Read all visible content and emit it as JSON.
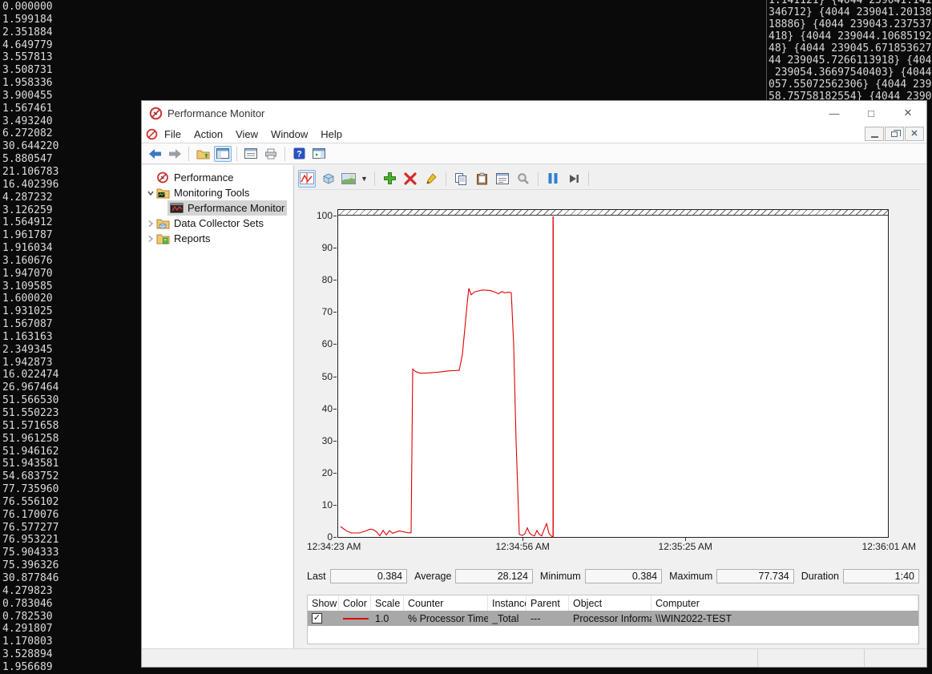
{
  "background_console": {
    "left_values": [
      "0.000000",
      "1.599184",
      "2.351884",
      "4.649779",
      "3.557813",
      "3.508731",
      "1.958336",
      "3.900455",
      "1.567461",
      "3.493240",
      "6.272082",
      "30.644220",
      "5.880547",
      "21.106783",
      "16.402396",
      "4.287232",
      "3.126259",
      "1.564912",
      "1.961787",
      "1.916034",
      "3.160676",
      "1.947070",
      "3.109585",
      "1.600020",
      "1.931025",
      "1.567087",
      "1.163163",
      "2.349345",
      "1.942873",
      "16.022474",
      "26.967464",
      "51.566530",
      "51.550223",
      "51.571658",
      "51.961258",
      "51.946162",
      "51.943581",
      "54.683752",
      "77.735960",
      "76.556102",
      "76.170076",
      "76.577277",
      "76.953221",
      "75.904333",
      "75.396326",
      "30.877846",
      "4.279823",
      "0.783046",
      "0.782530",
      "4.291807",
      "1.170803",
      "3.528894",
      "1.956689"
    ],
    "top_right_lines": [
      "1.141121} {4044 239041.141",
      "346712} {4044 239041.20138",
      "18886} {4044 239043.237537",
      "418} {4044 239044.10685192",
      "48} {4044 239045.671853627",
      "44 239045.7266113918} {404",
      " 239054.36697540403} {4044",
      "057.55072562306} {4044 239",
      "58.75758182554} {4044 2390"
    ]
  },
  "window": {
    "title": "Performance Monitor",
    "controls": {
      "minimize": "—",
      "maximize": "□",
      "close": "✕"
    }
  },
  "menu": {
    "items": [
      "File",
      "Action",
      "View",
      "Window",
      "Help"
    ]
  },
  "tree": {
    "root": "Performance",
    "items": [
      {
        "label": "Monitoring Tools",
        "expanded": true
      },
      {
        "label": "Performance Monitor",
        "selected": true
      },
      {
        "label": "Data Collector Sets",
        "expanded": false
      },
      {
        "label": "Reports",
        "expanded": false
      }
    ]
  },
  "chart_data": {
    "type": "line",
    "title": "",
    "xlabel": "",
    "ylabel": "",
    "ylim": [
      0,
      100
    ],
    "grid": false,
    "y_ticks": [
      100,
      90,
      80,
      70,
      60,
      50,
      40,
      30,
      20,
      10,
      0
    ],
    "x_tick_labels": [
      "12:34:23 AM",
      "12:34:56 AM",
      "12:35:25 AM",
      "12:36:01 AM"
    ],
    "x_tick_percents": [
      0,
      33.7,
      63.3,
      100
    ],
    "time_marker_percent": 39.1,
    "plot_width_units": 686,
    "series": [
      {
        "name": "% Processor Time",
        "color": "#e00000",
        "points": [
          [
            3,
            3.5
          ],
          [
            10,
            2.2
          ],
          [
            16,
            1.5
          ],
          [
            26,
            1.5
          ],
          [
            33,
            2.0
          ],
          [
            40,
            2.7
          ],
          [
            44,
            2.5
          ],
          [
            48,
            1.8
          ],
          [
            52,
            0.6
          ],
          [
            56,
            2.3
          ],
          [
            60,
            0.9
          ],
          [
            64,
            2.2
          ],
          [
            68,
            1.4
          ],
          [
            76,
            2.1
          ],
          [
            81,
            1.9
          ],
          [
            88,
            1.5
          ],
          [
            91,
            1.6
          ],
          [
            93,
            52.5
          ],
          [
            96,
            51.8
          ],
          [
            101,
            51.3
          ],
          [
            106,
            51.2
          ],
          [
            113,
            51.3
          ],
          [
            123,
            51.5
          ],
          [
            131,
            51.7
          ],
          [
            136,
            51.9
          ],
          [
            143,
            52.0
          ],
          [
            151,
            52.1
          ],
          [
            155,
            57.0
          ],
          [
            158,
            65.0
          ],
          [
            161,
            73.0
          ],
          [
            163,
            77.6
          ],
          [
            166,
            75.6
          ],
          [
            170,
            76.5
          ],
          [
            175,
            76.8
          ],
          [
            180,
            77.1
          ],
          [
            185,
            77.0
          ],
          [
            190,
            76.9
          ],
          [
            196,
            76.4
          ],
          [
            200,
            75.9
          ],
          [
            204,
            76.6
          ],
          [
            208,
            76.2
          ],
          [
            213,
            76.4
          ],
          [
            216,
            76.2
          ],
          [
            219,
            60.0
          ],
          [
            222,
            30.0
          ],
          [
            226,
            1.0
          ],
          [
            230,
            0.7
          ],
          [
            233,
            1.3
          ],
          [
            236,
            3.1
          ],
          [
            239,
            1.4
          ],
          [
            242,
            0.8
          ],
          [
            245,
            0.6
          ],
          [
            248,
            2.3
          ],
          [
            251,
            1.0
          ],
          [
            254,
            0.6
          ],
          [
            257,
            2.6
          ],
          [
            260,
            4.4
          ],
          [
            263,
            1.4
          ],
          [
            266,
            0.5
          ],
          [
            268,
            0.4
          ]
        ]
      }
    ]
  },
  "stats": {
    "labels": {
      "last": "Last",
      "average": "Average",
      "minimum": "Minimum",
      "maximum": "Maximum",
      "duration": "Duration"
    },
    "values": {
      "last": "0.384",
      "average": "28.124",
      "minimum": "0.384",
      "maximum": "77.734",
      "duration": "1:40"
    }
  },
  "counter_table": {
    "headers": [
      "Show",
      "Color",
      "Scale",
      "Counter",
      "Instance",
      "Parent",
      "Object",
      "Computer"
    ],
    "rows": [
      {
        "show": true,
        "color": "#e00000",
        "scale": "1.0",
        "counter": "% Processor Time",
        "instance": "_Total",
        "parent": "---",
        "object": "Processor Information",
        "computer": "\\\\WIN2022-TEST",
        "selected": true
      }
    ]
  }
}
